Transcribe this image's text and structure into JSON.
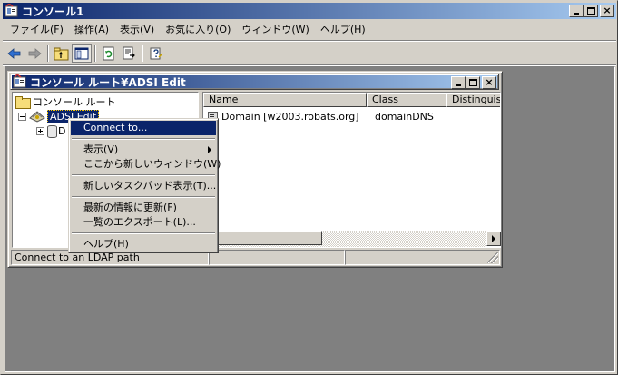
{
  "app": {
    "title": "コンソール1",
    "icon": "mmc-console-icon"
  },
  "menubar": {
    "items": [
      {
        "label": "ファイル(F)"
      },
      {
        "label": "操作(A)"
      },
      {
        "label": "表示(V)"
      },
      {
        "label": "お気に入り(O)"
      },
      {
        "label": "ウィンドウ(W)"
      },
      {
        "label": "ヘルプ(H)"
      }
    ]
  },
  "toolbar": {
    "icons": [
      "back-arrow-icon",
      "forward-arrow-icon",
      "up-folder-icon",
      "show-hide-tree-icon",
      "refresh-icon",
      "export-list-icon",
      "help-icon"
    ]
  },
  "child_window": {
    "title": "コンソール ルート¥ADSI Edit"
  },
  "tree": {
    "root_label": "コンソール ルート",
    "adsi_label": "ADSI Edit",
    "child_label": "D"
  },
  "list": {
    "columns": [
      "Name",
      "Class",
      "Distinguis"
    ],
    "rows": [
      {
        "name": "Domain [w2003.robats.org]",
        "class": "domainDNS",
        "dn": ""
      }
    ]
  },
  "status": {
    "text": "Connect to an LDAP path",
    "cells": [
      "",
      ""
    ]
  },
  "context_menu": {
    "items": [
      {
        "label": "Connect to...",
        "highlighted": true
      },
      {
        "separator": true
      },
      {
        "label": "表示(V)",
        "submenu": true
      },
      {
        "label": "ここから新しいウィンドウ(W)"
      },
      {
        "separator": true
      },
      {
        "label": "新しいタスクパッド表示(T)..."
      },
      {
        "separator": true
      },
      {
        "label": "最新の情報に更新(F)"
      },
      {
        "label": "一覧のエクスポート(L)..."
      },
      {
        "separator": true
      },
      {
        "label": "ヘルプ(H)"
      }
    ]
  },
  "colors": {
    "titlebar_start": "#0a246a",
    "titlebar_end": "#a6caf0",
    "face": "#d4d0c8",
    "mdi_background": "#808080",
    "highlight": "#0a246a"
  }
}
